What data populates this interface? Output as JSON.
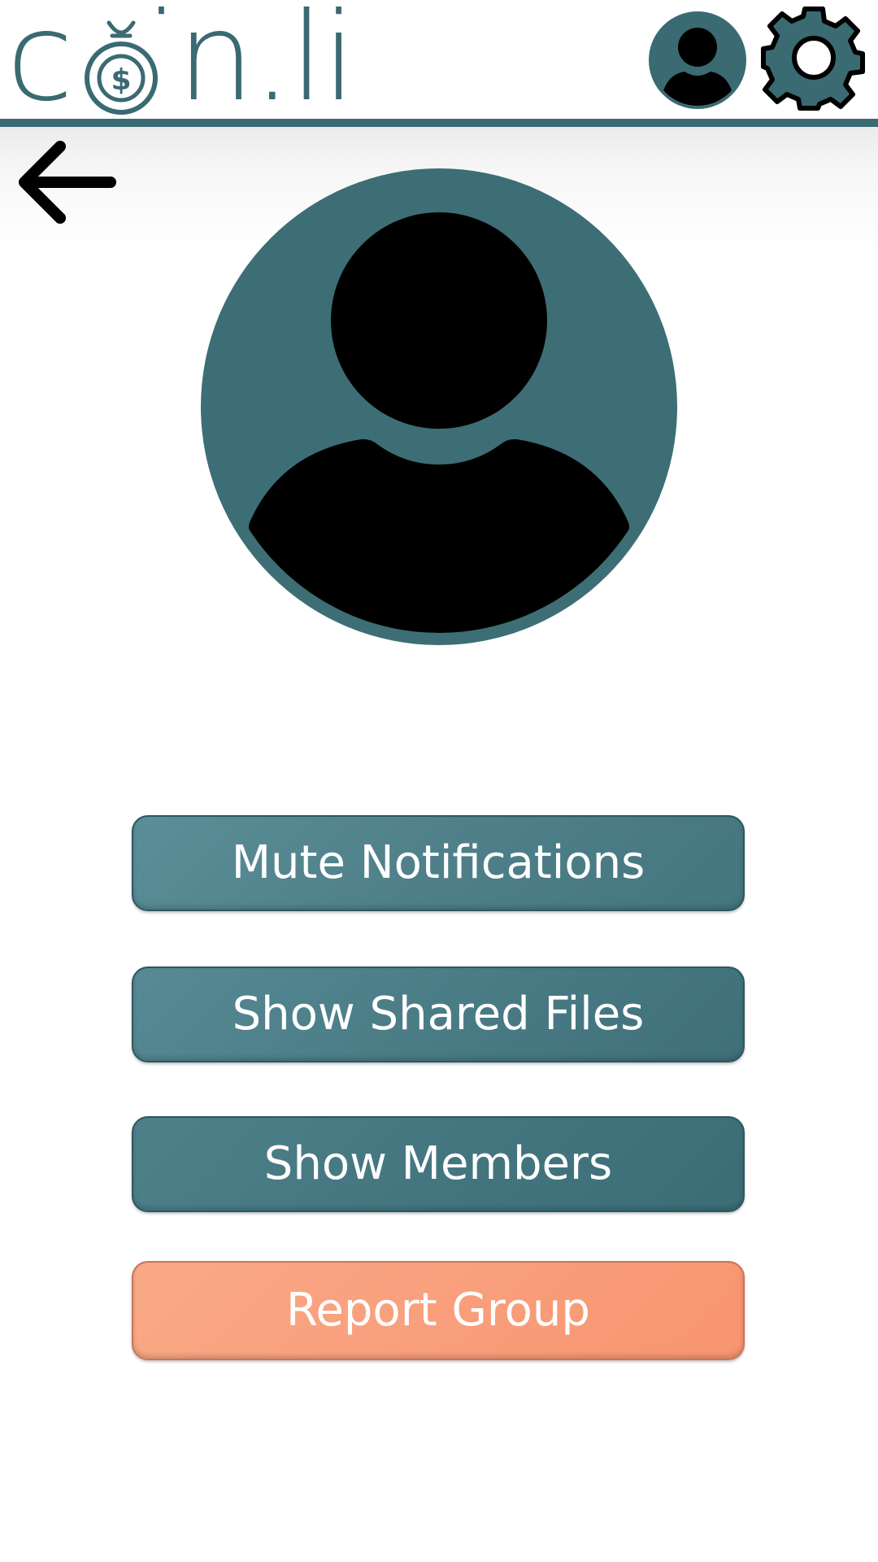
{
  "app": {
    "logo_text": "coin.li"
  },
  "header": {
    "profile_icon": "user-avatar-icon",
    "settings_icon": "gear-icon"
  },
  "nav": {
    "back_icon": "arrow-left-icon"
  },
  "group": {
    "avatar_icon": "group-avatar-placeholder-icon"
  },
  "actions": {
    "mute_label": "Mute Notifications",
    "files_label": "Show Shared Files",
    "members_label": "Show Members",
    "report_label": "Report Group"
  },
  "colors": {
    "brand_teal": "#3a6a72",
    "button_teal": "#4f8089",
    "report_orange": "#f99f7c",
    "white": "#ffffff",
    "black": "#000000"
  }
}
